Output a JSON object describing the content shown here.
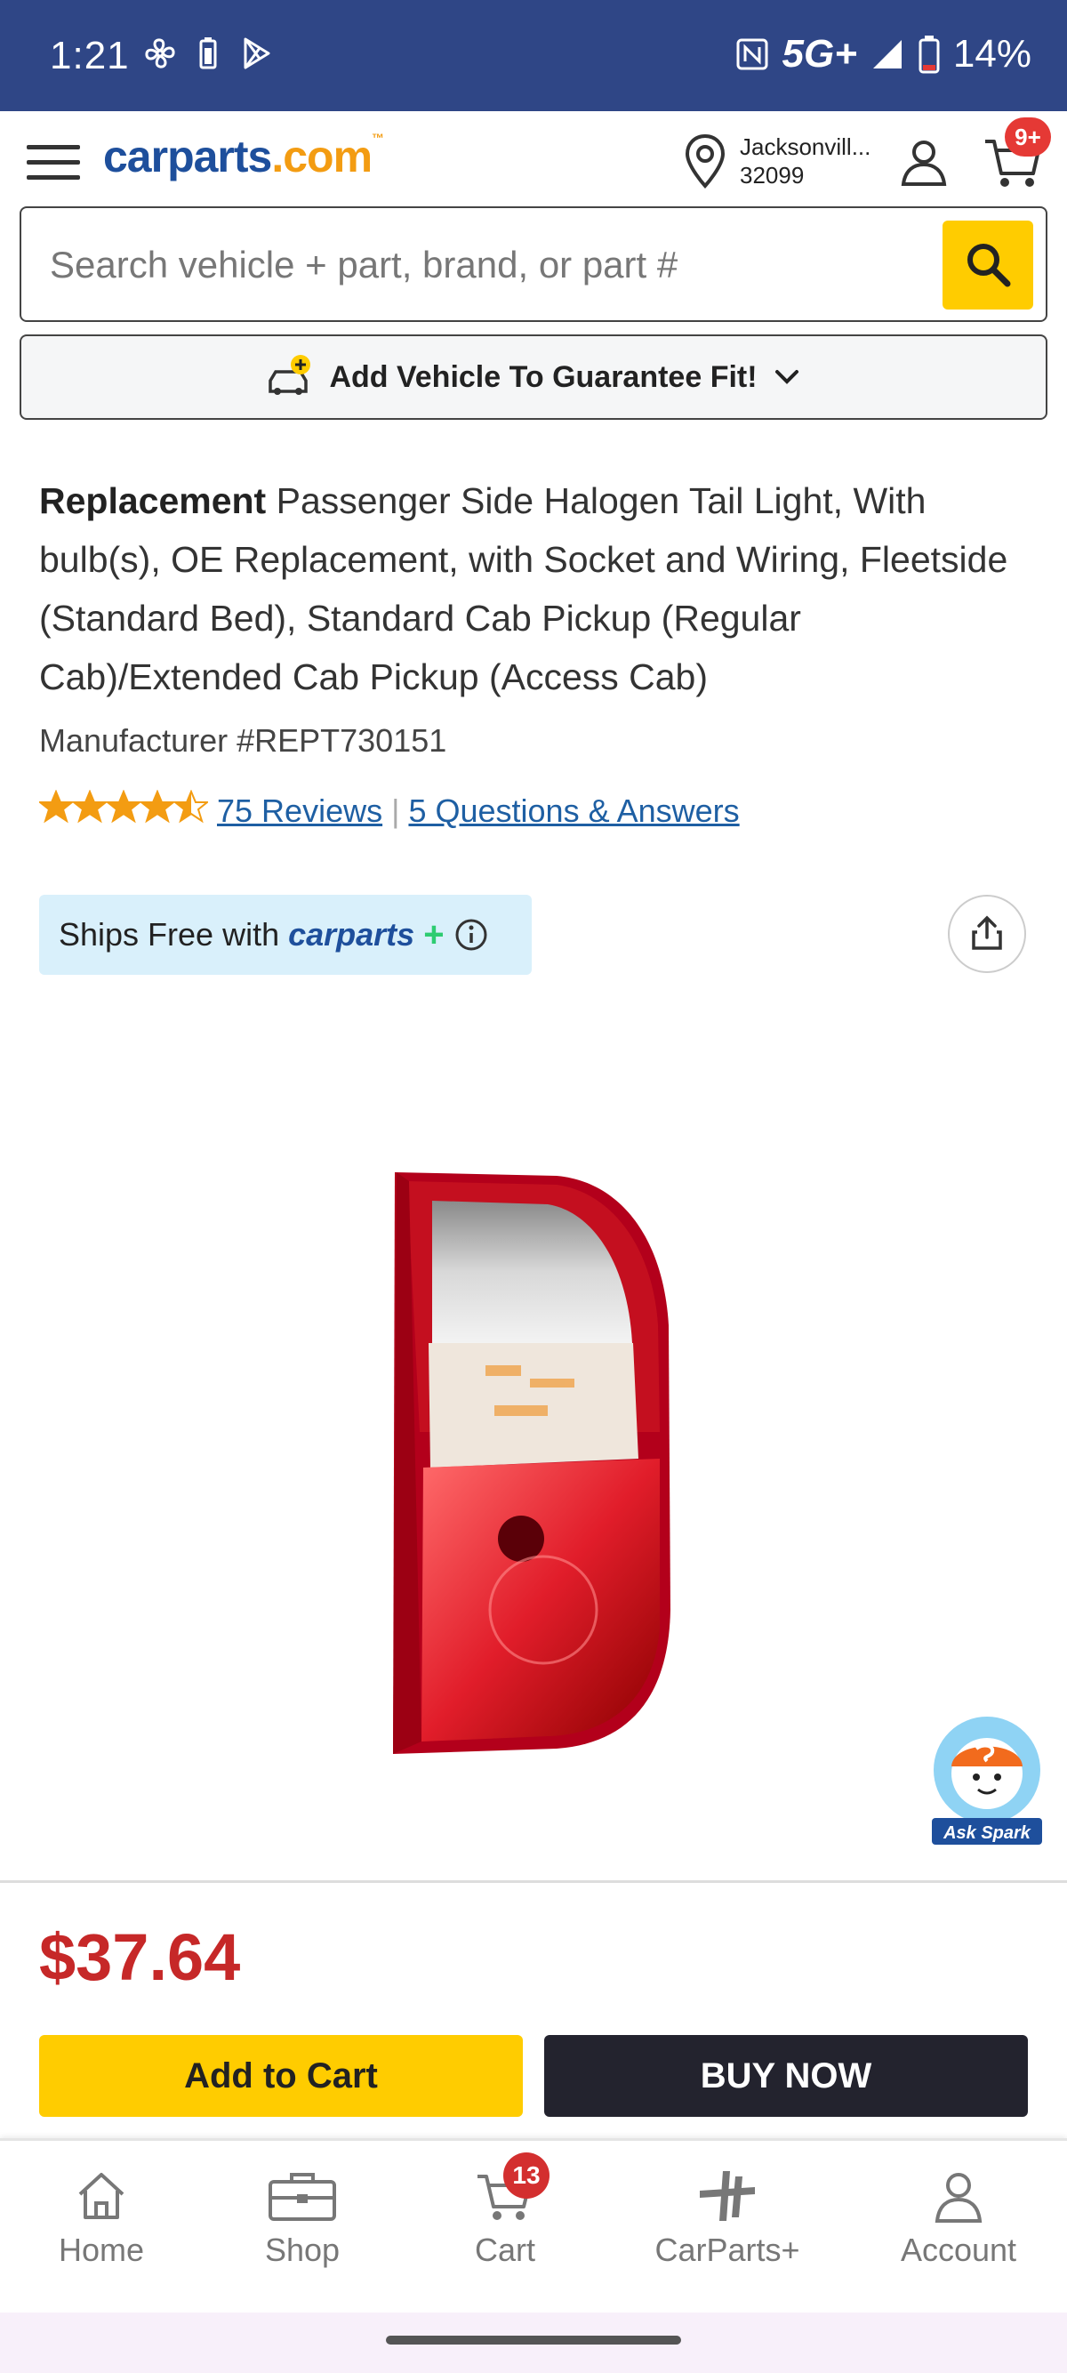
{
  "status_bar": {
    "time": "1:21",
    "network": "5G+",
    "battery": "14%"
  },
  "header": {
    "logo_main": "carparts",
    "logo_domain": ".com",
    "logo_tm": "™",
    "location_city": "Jacksonvill...",
    "location_zip": "32099",
    "cart_badge": "9+"
  },
  "search": {
    "placeholder": "Search vehicle + part, brand, or part #"
  },
  "vehicle": {
    "label": "Add Vehicle To Guarantee Fit!"
  },
  "product": {
    "title_bold": "Replacement",
    "title_rest": " Passenger Side Halogen Tail Light, With bulb(s), OE Replacement, with Socket and Wiring, Fleetside (Standard Bed), Standard Cab Pickup (Regular Cab)/Extended Cab Pickup (Access Cab)",
    "manufacturer": "Manufacturer #REPT730151",
    "rating": 4.5,
    "reviews_link": "75 Reviews",
    "qa_link": "5 Questions & Answers",
    "ships_free_text": "Ships Free with",
    "ships_free_brand": "carparts",
    "ships_free_plus": "+",
    "price": "$37.64",
    "add_to_cart": "Add to Cart",
    "buy_now": "BUY NOW"
  },
  "spark": {
    "label": "Ask Spark"
  },
  "bottom_nav": {
    "items": [
      {
        "label": "Home",
        "icon": "home-icon"
      },
      {
        "label": "Shop",
        "icon": "toolbox-icon"
      },
      {
        "label": "Cart",
        "icon": "cart-icon"
      },
      {
        "label": "CarParts+",
        "icon": "carparts-plus-icon"
      },
      {
        "label": "Account",
        "icon": "account-icon"
      }
    ],
    "cart_badge": "13"
  },
  "colors": {
    "brand_blue": "#1e4f9c",
    "accent_yellow": "#ffcc00",
    "price_red": "#c62828",
    "status_bar": "#2f4686"
  }
}
